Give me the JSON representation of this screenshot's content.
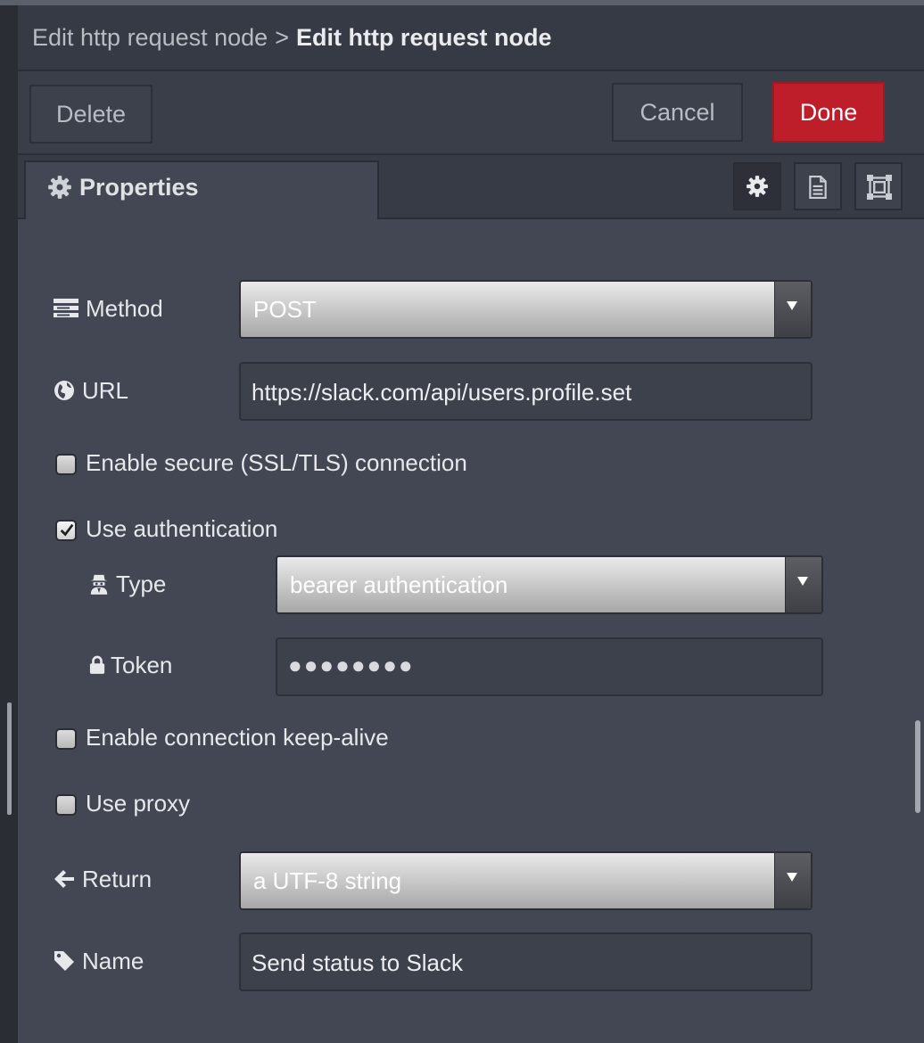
{
  "breadcrumb": {
    "parent": "Edit http request node",
    "separator": ">",
    "current": "Edit http request node"
  },
  "toolbar": {
    "delete_label": "Delete",
    "cancel_label": "Cancel",
    "done_label": "Done",
    "done_color": "#be1e2a"
  },
  "tabs": {
    "properties_label": "Properties",
    "properties_icon": "gear-icon",
    "side_icons": [
      "gear-icon",
      "description-icon",
      "appearance-icon"
    ]
  },
  "form": {
    "method": {
      "label": "Method",
      "icon": "list-icon",
      "value": "POST"
    },
    "url": {
      "label": "URL",
      "icon": "globe-icon",
      "value": "https://slack.com/api/users.profile.set"
    },
    "ssl": {
      "label": "Enable secure (SSL/TLS) connection",
      "checked": false
    },
    "auth": {
      "label": "Use authentication",
      "checked": true
    },
    "auth_type": {
      "label": "Type",
      "icon": "user-secret-icon",
      "value": "bearer authentication"
    },
    "token": {
      "label": "Token",
      "icon": "lock-icon",
      "value": "●●●●●●●●"
    },
    "keepalive": {
      "label": "Enable connection keep-alive",
      "checked": false
    },
    "proxy": {
      "label": "Use proxy",
      "checked": false
    },
    "return": {
      "label": "Return",
      "icon": "arrow-left-icon",
      "value": "a UTF-8 string"
    },
    "name": {
      "label": "Name",
      "icon": "tag-icon",
      "value": "Send status to Slack"
    }
  }
}
